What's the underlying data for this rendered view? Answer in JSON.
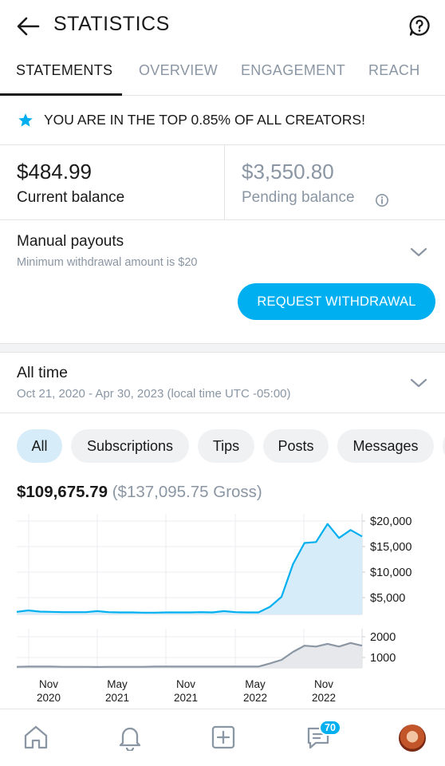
{
  "header": {
    "title": "STATISTICS"
  },
  "tabs": [
    {
      "label": "STATEMENTS",
      "active": true
    },
    {
      "label": "OVERVIEW"
    },
    {
      "label": "ENGAGEMENT"
    },
    {
      "label": "REACH"
    }
  ],
  "banner": {
    "text": "YOU ARE IN THE TOP 0.85% OF ALL CREATORS!"
  },
  "balances": {
    "current": {
      "amount": "$484.99",
      "label": "Current balance"
    },
    "pending": {
      "amount": "$3,550.80",
      "label": "Pending balance"
    }
  },
  "payouts": {
    "title": "Manual payouts",
    "subtitle": "Minimum withdrawal amount is $20",
    "button": "REQUEST WITHDRAWAL"
  },
  "period": {
    "title": "All time",
    "range": "Oct 21, 2020 - Apr 30, 2023 (local time UTC -05:00)"
  },
  "filters": [
    {
      "label": "All",
      "active": true
    },
    {
      "label": "Subscriptions"
    },
    {
      "label": "Tips"
    },
    {
      "label": "Posts"
    },
    {
      "label": "Messages"
    }
  ],
  "totals": {
    "net": "$109,675.79",
    "gross": "($137,095.75 Gross)"
  },
  "chart_data": [
    {
      "type": "area",
      "title": "",
      "x": [
        "Oct 2020",
        "Nov 2020",
        "Dec 2020",
        "Jan 2021",
        "Feb 2021",
        "Mar 2021",
        "Apr 2021",
        "May 2021",
        "Jun 2021",
        "Jul 2021",
        "Aug 2021",
        "Sep 2021",
        "Oct 2021",
        "Nov 2021",
        "Dec 2021",
        "Jan 2022",
        "Feb 2022",
        "Mar 2022",
        "Apr 2022",
        "May 2022",
        "Jun 2022",
        "Jul 2022",
        "Aug 2022",
        "Sep 2022",
        "Oct 2022",
        "Nov 2022",
        "Dec 2022",
        "Jan 2023",
        "Feb 2023",
        "Mar 2023",
        "Apr 2023"
      ],
      "series": [
        {
          "values": [
            500,
            800,
            550,
            500,
            450,
            450,
            450,
            650,
            450,
            400,
            400,
            350,
            350,
            400,
            400,
            400,
            450,
            400,
            650,
            450,
            400,
            400,
            1500,
            3500,
            10000,
            14200,
            14400,
            18000,
            15200,
            16800,
            15500
          ]
        }
      ],
      "x_tick_labels": [
        "Nov\n2020",
        "May\n2021",
        "Nov\n2021",
        "May\n2022",
        "Nov\n2022"
      ],
      "y_tick_labels": [
        "$20,000",
        "$15,000",
        "$10,000",
        "$5,000"
      ],
      "ylim": [
        0,
        20000
      ],
      "color": "#00aff0",
      "fill": "#d6ecf8",
      "grid": true
    },
    {
      "type": "area",
      "title": "",
      "x": [
        "Oct 2020",
        "Nov 2020",
        "Dec 2020",
        "Jan 2021",
        "Feb 2021",
        "Mar 2021",
        "Apr 2021",
        "May 2021",
        "Jun 2021",
        "Jul 2021",
        "Aug 2021",
        "Sep 2021",
        "Oct 2021",
        "Nov 2021",
        "Dec 2021",
        "Jan 2022",
        "Feb 2022",
        "Mar 2022",
        "Apr 2022",
        "May 2022",
        "Jun 2022",
        "Jul 2022",
        "Aug 2022",
        "Sep 2022",
        "Oct 2022",
        "Nov 2022",
        "Dec 2022",
        "Jan 2023",
        "Feb 2023",
        "Mar 2023",
        "Apr 2023"
      ],
      "series": [
        {
          "values": [
            60,
            70,
            70,
            70,
            60,
            60,
            60,
            50,
            60,
            60,
            60,
            60,
            70,
            70,
            70,
            70,
            70,
            70,
            70,
            70,
            70,
            70,
            250,
            450,
            900,
            1250,
            1200,
            1350,
            1200,
            1400,
            1250
          ]
        }
      ],
      "y_tick_labels": [
        "2000",
        "1000"
      ],
      "ylim": [
        0,
        2200
      ],
      "color": "#8a96a3",
      "fill": "#e6e8eb",
      "grid": true
    }
  ],
  "nav": {
    "badge": "70"
  },
  "colors": {
    "accent": "#00aff0",
    "muted": "#8a96a3",
    "divider": "#e2e4e6"
  },
  "icons": [
    "back-arrow-icon",
    "help-icon",
    "star-icon",
    "info-icon",
    "chevron-down-icon",
    "home-icon",
    "bell-icon",
    "plus-square-icon",
    "messages-icon"
  ]
}
